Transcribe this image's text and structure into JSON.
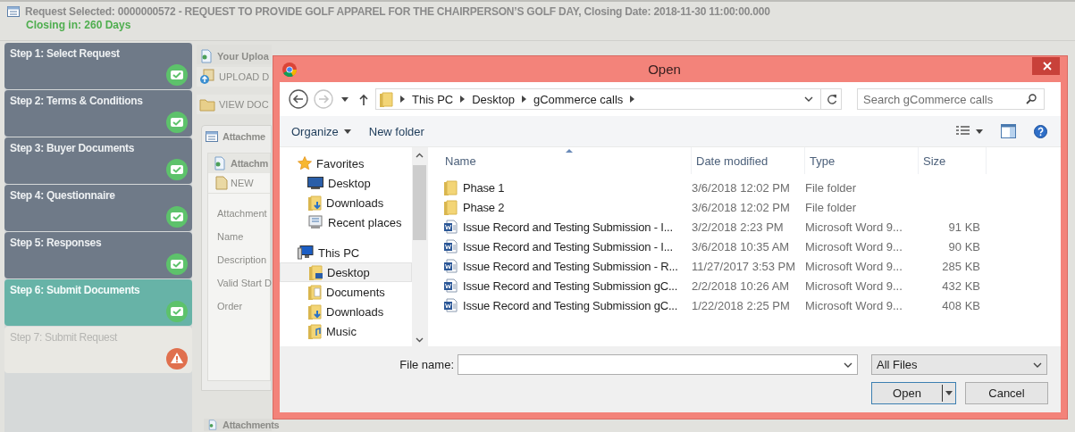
{
  "header": {
    "title": "Request Selected: 0000000572 - REQUEST TO PROVIDE GOLF APPAREL FOR THE CHAIRPERSON’S GOLF DAY, Closing Date: 2018-11-30 11:00:00.000",
    "closing": "Closing in: 260 Days"
  },
  "steps": [
    {
      "label": "Step 1: Select Request",
      "complete": true,
      "selected": false
    },
    {
      "label": "Step 2: Terms & Conditions",
      "complete": true,
      "selected": false
    },
    {
      "label": "Step 3: Buyer Documents",
      "complete": true,
      "selected": false
    },
    {
      "label": "Step 4: Questionnaire",
      "complete": true,
      "selected": false
    },
    {
      "label": "Step 5: Responses",
      "complete": true,
      "selected": false
    },
    {
      "label": "Step 6: Submit Documents",
      "complete": true,
      "selected": true
    },
    {
      "label": "Step 7: Submit Request",
      "complete": false,
      "selected": false
    }
  ],
  "content": {
    "items": [
      {
        "kind": "header",
        "label": "Your Uploa"
      },
      {
        "kind": "upload",
        "label": "UPLOAD D"
      },
      {
        "kind": "view",
        "label": "VIEW DOC"
      }
    ],
    "panel_title": "Attachme",
    "subpanel_title": "Attachm",
    "toolbar_button": "NEW",
    "form_labels": [
      "Attachment",
      "Name",
      "Description",
      "Valid Start D",
      "Order"
    ],
    "footer_title": "Attachments"
  },
  "dialog": {
    "title": "Open",
    "history_buttons": [
      {
        "kind": "back",
        "disabled": false
      },
      {
        "kind": "forward",
        "disabled": true
      }
    ],
    "breadcrumbs": [
      "This PC",
      "Desktop",
      "gCommerce calls"
    ],
    "search": {
      "placeholder": "Search gCommerce calls"
    },
    "toolbar": {
      "organize": "Organize",
      "new_folder": "New folder"
    },
    "nav_tree": [
      {
        "label": "Favorites",
        "kind": "star",
        "selected": false,
        "children": [
          {
            "label": "Desktop",
            "kind": "monitor",
            "selected": false
          },
          {
            "label": "Downloads",
            "kind": "download",
            "selected": false
          },
          {
            "label": "Recent places",
            "kind": "recent",
            "selected": false
          }
        ]
      },
      {
        "label": "This PC",
        "kind": "computer",
        "selected": false,
        "children": [
          {
            "label": "Desktop",
            "kind": "desktop",
            "selected": true
          },
          {
            "label": "Documents",
            "kind": "documents",
            "selected": false
          },
          {
            "label": "Downloads",
            "kind": "download",
            "selected": false
          },
          {
            "label": "Music",
            "kind": "music",
            "selected": false
          }
        ]
      }
    ],
    "columns": [
      {
        "label": "Name",
        "sorted": true
      },
      {
        "label": "Date modified",
        "sorted": false
      },
      {
        "label": "Type",
        "sorted": false
      },
      {
        "label": "Size",
        "sorted": false
      }
    ],
    "files": [
      {
        "kind": "folder",
        "name": "Phase 1",
        "date": "3/6/2018 12:02 PM",
        "type": "File folder",
        "selected": false
      },
      {
        "kind": "folder",
        "name": "Phase 2",
        "date": "3/6/2018 12:02 PM",
        "type": "File folder",
        "selected": false
      },
      {
        "kind": "word",
        "name": "Issue Record and Testing Submission  - I...",
        "date": "3/2/2018 2:23 PM",
        "type": "Microsoft Word 9...",
        "size": "91 KB",
        "selected": false
      },
      {
        "kind": "word",
        "name": "Issue Record and Testing Submission  - I...",
        "date": "3/6/2018 10:35 AM",
        "type": "Microsoft Word 9...",
        "size": "90 KB",
        "selected": false
      },
      {
        "kind": "word",
        "name": "Issue Record and Testing Submission  - R...",
        "date": "11/27/2017 3:53 PM",
        "type": "Microsoft Word 9...",
        "size": "285 KB",
        "selected": false
      },
      {
        "kind": "word",
        "name": "Issue Record and Testing Submission gC...",
        "date": "2/2/2018 10:26 AM",
        "type": "Microsoft Word 9...",
        "size": "432 KB",
        "selected": false
      },
      {
        "kind": "word",
        "name": "Issue Record and Testing Submission gC...",
        "date": "1/22/2018 2:25 PM",
        "type": "Microsoft Word 9...",
        "size": "408 KB",
        "selected": false
      }
    ],
    "file_name_label": "File name:",
    "file_type": "All Files",
    "buttons": {
      "open": "Open",
      "cancel": "Cancel"
    }
  }
}
